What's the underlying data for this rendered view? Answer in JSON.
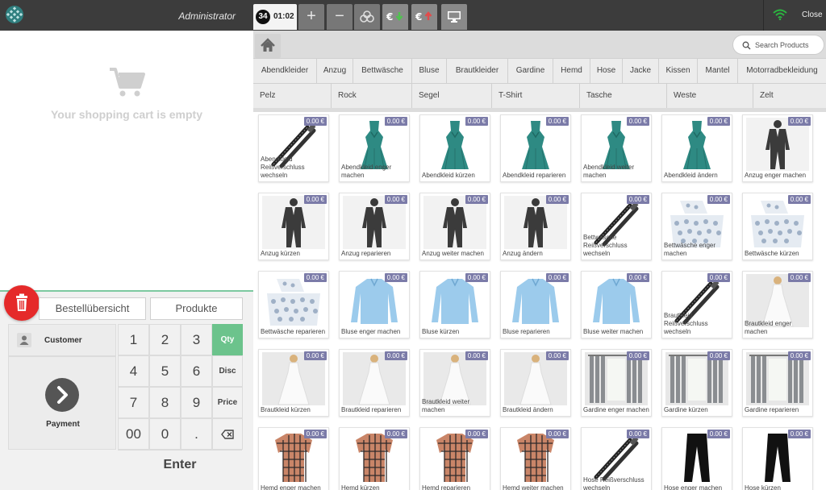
{
  "topbar": {
    "user": "Administrator",
    "ticket_number": "34",
    "ticket_time": "01:02",
    "close_label": "Close",
    "wifi_color": "#2bb640",
    "buttons": [
      {
        "icon": "plus-icon",
        "symbol": "+"
      },
      {
        "icon": "minus-icon",
        "symbol": "−"
      },
      {
        "icon": "group-icon",
        "symbol": ""
      },
      {
        "icon": "cash-in-icon",
        "symbol": "€"
      },
      {
        "icon": "cash-out-icon",
        "symbol": "€"
      },
      {
        "icon": "monitor-icon",
        "symbol": ""
      }
    ]
  },
  "cart": {
    "empty_text": "Your shopping cart is empty"
  },
  "tabs": {
    "order_overview": "Bestellübersicht",
    "products": "Produkte"
  },
  "keypad": {
    "customer": "Customer",
    "payment": "Payment",
    "enter": "Enter",
    "digits": [
      "1",
      "2",
      "3",
      "4",
      "5",
      "6",
      "7",
      "8",
      "9",
      "00",
      "0",
      "."
    ],
    "functions": [
      "Qty",
      "Disc",
      "Price"
    ],
    "accent": "#6cc38c"
  },
  "search": {
    "placeholder": "Search Products"
  },
  "categories_row1": [
    "Abendkleider",
    "Anzug",
    "Bettwäsche",
    "Bluse",
    "Brautkleider",
    "Gardine",
    "Hemd",
    "Hose",
    "Jacke",
    "Kissen",
    "Mantel",
    "Motorradbekleidung"
  ],
  "categories_row2": [
    "Pelz",
    "Rock",
    "Segel",
    "T-Shirt",
    "Tasche",
    "Weste",
    "Zelt"
  ],
  "products": [
    {
      "name": "Abendkleid Reißverschluss wechseln",
      "price": "0.00 €",
      "icon": "zipper"
    },
    {
      "name": "Abendkleid enger machen",
      "price": "0.00 €",
      "icon": "dress"
    },
    {
      "name": "Abendkleid kürzen",
      "price": "0.00 €",
      "icon": "dress"
    },
    {
      "name": "Abendkleid reparieren",
      "price": "0.00 €",
      "icon": "dress"
    },
    {
      "name": "Abendkleid weiter machen",
      "price": "0.00 €",
      "icon": "dress"
    },
    {
      "name": "Abendkleid ändern",
      "price": "0.00 €",
      "icon": "dress"
    },
    {
      "name": "Anzug enger machen",
      "price": "0.00 €",
      "icon": "suit"
    },
    {
      "name": "Anzug kürzen",
      "price": "0.00 €",
      "icon": "suit"
    },
    {
      "name": "Anzug reparieren",
      "price": "0.00 €",
      "icon": "suit"
    },
    {
      "name": "Anzug weiter machen",
      "price": "0.00 €",
      "icon": "suit"
    },
    {
      "name": "Anzug ändern",
      "price": "0.00 €",
      "icon": "suit"
    },
    {
      "name": "Bettwäsche Reißverschluss wechseln",
      "price": "0.00 €",
      "icon": "zipper"
    },
    {
      "name": "Bettwäsche enger machen",
      "price": "0.00 €",
      "icon": "bedding"
    },
    {
      "name": "Bettwäsche kürzen",
      "price": "0.00 €",
      "icon": "bedding"
    },
    {
      "name": "Bettwäsche reparieren",
      "price": "0.00 €",
      "icon": "bedding"
    },
    {
      "name": "Bluse enger machen",
      "price": "0.00 €",
      "icon": "blouse"
    },
    {
      "name": "Bluse kürzen",
      "price": "0.00 €",
      "icon": "blouse"
    },
    {
      "name": "Bluse reparieren",
      "price": "0.00 €",
      "icon": "blouse"
    },
    {
      "name": "Bluse weiter machen",
      "price": "0.00 €",
      "icon": "blouse"
    },
    {
      "name": "Brautkleid Reißverschluss wechseln",
      "price": "0.00 €",
      "icon": "zipper"
    },
    {
      "name": "Brautkleid enger machen",
      "price": "0.00 €",
      "icon": "bride"
    },
    {
      "name": "Brautkleid kürzen",
      "price": "0.00 €",
      "icon": "bride"
    },
    {
      "name": "Brautkleid reparieren",
      "price": "0.00 €",
      "icon": "bride"
    },
    {
      "name": "Brautkleid weiter machen",
      "price": "0.00 €",
      "icon": "bride"
    },
    {
      "name": "Brautkleid ändern",
      "price": "0.00 €",
      "icon": "bride"
    },
    {
      "name": "Gardine enger machen",
      "price": "0.00 €",
      "icon": "curtain"
    },
    {
      "name": "Gardine kürzen",
      "price": "0.00 €",
      "icon": "curtain"
    },
    {
      "name": "Gardine reparieren",
      "price": "0.00 €",
      "icon": "curtain"
    },
    {
      "name": "Hemd enger machen",
      "price": "0.00 €",
      "icon": "shirt"
    },
    {
      "name": "Hemd kürzen",
      "price": "0.00 €",
      "icon": "shirt"
    },
    {
      "name": "Hemd reparieren",
      "price": "0.00 €",
      "icon": "shirt"
    },
    {
      "name": "Hemd weiter machen",
      "price": "0.00 €",
      "icon": "shirt"
    },
    {
      "name": "Hose Reißverschluss wechseln",
      "price": "0.00 €",
      "icon": "zipper"
    },
    {
      "name": "Hose enger machen",
      "price": "0.00 €",
      "icon": "pants"
    },
    {
      "name": "Hose kürzen",
      "price": "0.00 €",
      "icon": "pants"
    }
  ]
}
